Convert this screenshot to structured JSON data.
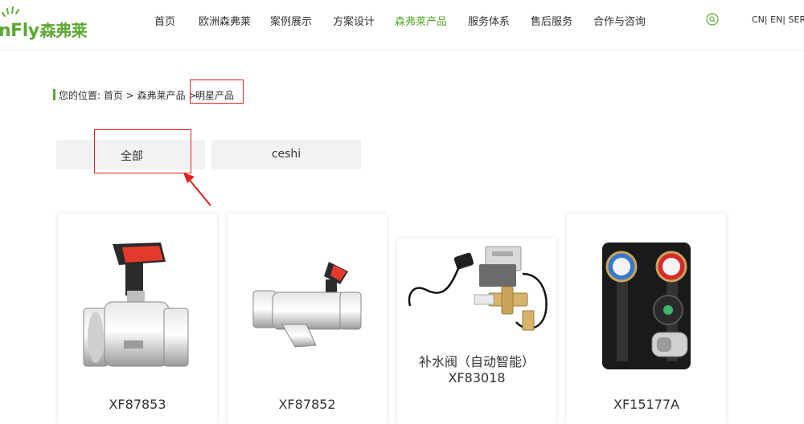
{
  "header": {
    "logo_text": "nFly",
    "logo_cn": "森弗莱",
    "nav": [
      {
        "label": "首页",
        "active": false
      },
      {
        "label": "欧洲森弗莱",
        "active": false
      },
      {
        "label": "案例展示",
        "active": false
      },
      {
        "label": "方案设计",
        "active": false
      },
      {
        "label": "森弗莱产品",
        "active": true
      },
      {
        "label": "服务体系",
        "active": false
      },
      {
        "label": "售后服务",
        "active": false
      },
      {
        "label": "合作与咨询",
        "active": false
      }
    ],
    "search_icon": "search-icon",
    "lang": {
      "cn": "CN|",
      "en": " EN|",
      "ser": " SER|"
    }
  },
  "breadcrumb": {
    "prefix": "您的位置:",
    "home": "首页",
    "sep1": ">",
    "category": "森弗莱产品",
    "sep2": ">",
    "current": "明星产品"
  },
  "tabs": {
    "all": "全部",
    "ceshi": "ceshi"
  },
  "products": [
    {
      "name": "XF87853"
    },
    {
      "name": "XF87852"
    },
    {
      "name_line1": "补水阀（自动智能）",
      "name_line2": "XF83018"
    },
    {
      "name": "XF15177A"
    }
  ],
  "colors": {
    "brand_green": "#5aa832",
    "annotation_red": "#e02020",
    "tab_bg": "#f2f2f2"
  }
}
